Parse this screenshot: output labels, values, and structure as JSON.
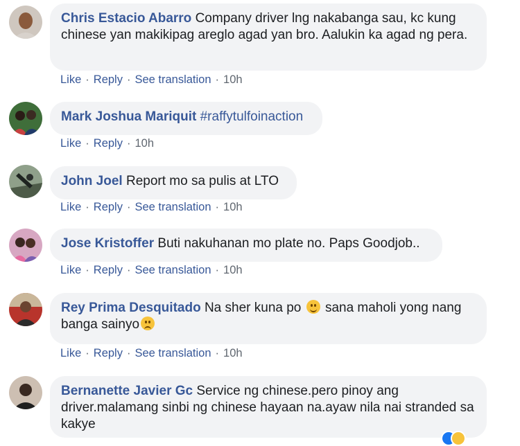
{
  "comments": [
    {
      "author": "Chris Estacio Abarro",
      "text": "Company driver lng nakabanga sau, kc kung chinese yan makikipag areglo agad yan bro. Aalukin ka agad ng pera.",
      "actions": {
        "like": "Like",
        "reply": "Reply",
        "translate": "See translation",
        "time": "10h"
      }
    },
    {
      "author": "Mark Joshua Mariquit",
      "hashtag": "#raffytulfoinaction",
      "actions": {
        "like": "Like",
        "reply": "Reply",
        "time": "10h"
      }
    },
    {
      "author": "John Joel",
      "text": "Report mo sa pulis at LTO",
      "actions": {
        "like": "Like",
        "reply": "Reply",
        "translate": "See translation",
        "time": "10h"
      }
    },
    {
      "author": "Jose Kristoffer",
      "text": "Buti nakuhanan mo plate no. Paps Goodjob..",
      "actions": {
        "like": "Like",
        "reply": "Reply",
        "translate": "See translation",
        "time": "10h"
      }
    },
    {
      "author": "Rey Prima Desquitado",
      "text_a": "Na sher kuna po",
      "emoji_a": "smiling-face-emoji",
      "text_b": "sana maholi yong nang banga sainyo",
      "emoji_b": "pensive-face-emoji",
      "actions": {
        "like": "Like",
        "reply": "Reply",
        "translate": "See translation",
        "time": "10h"
      }
    },
    {
      "author": "Bernanette Javier Gc",
      "text": "Service ng chinese.pero pinoy ang driver.malamang sinbi ng chinese hayaan na.ayaw nila nai stranded sa kakye"
    }
  ],
  "colors": {
    "author": "#385898",
    "bubble_bg": "#f2f3f5",
    "meta": "#606770"
  }
}
